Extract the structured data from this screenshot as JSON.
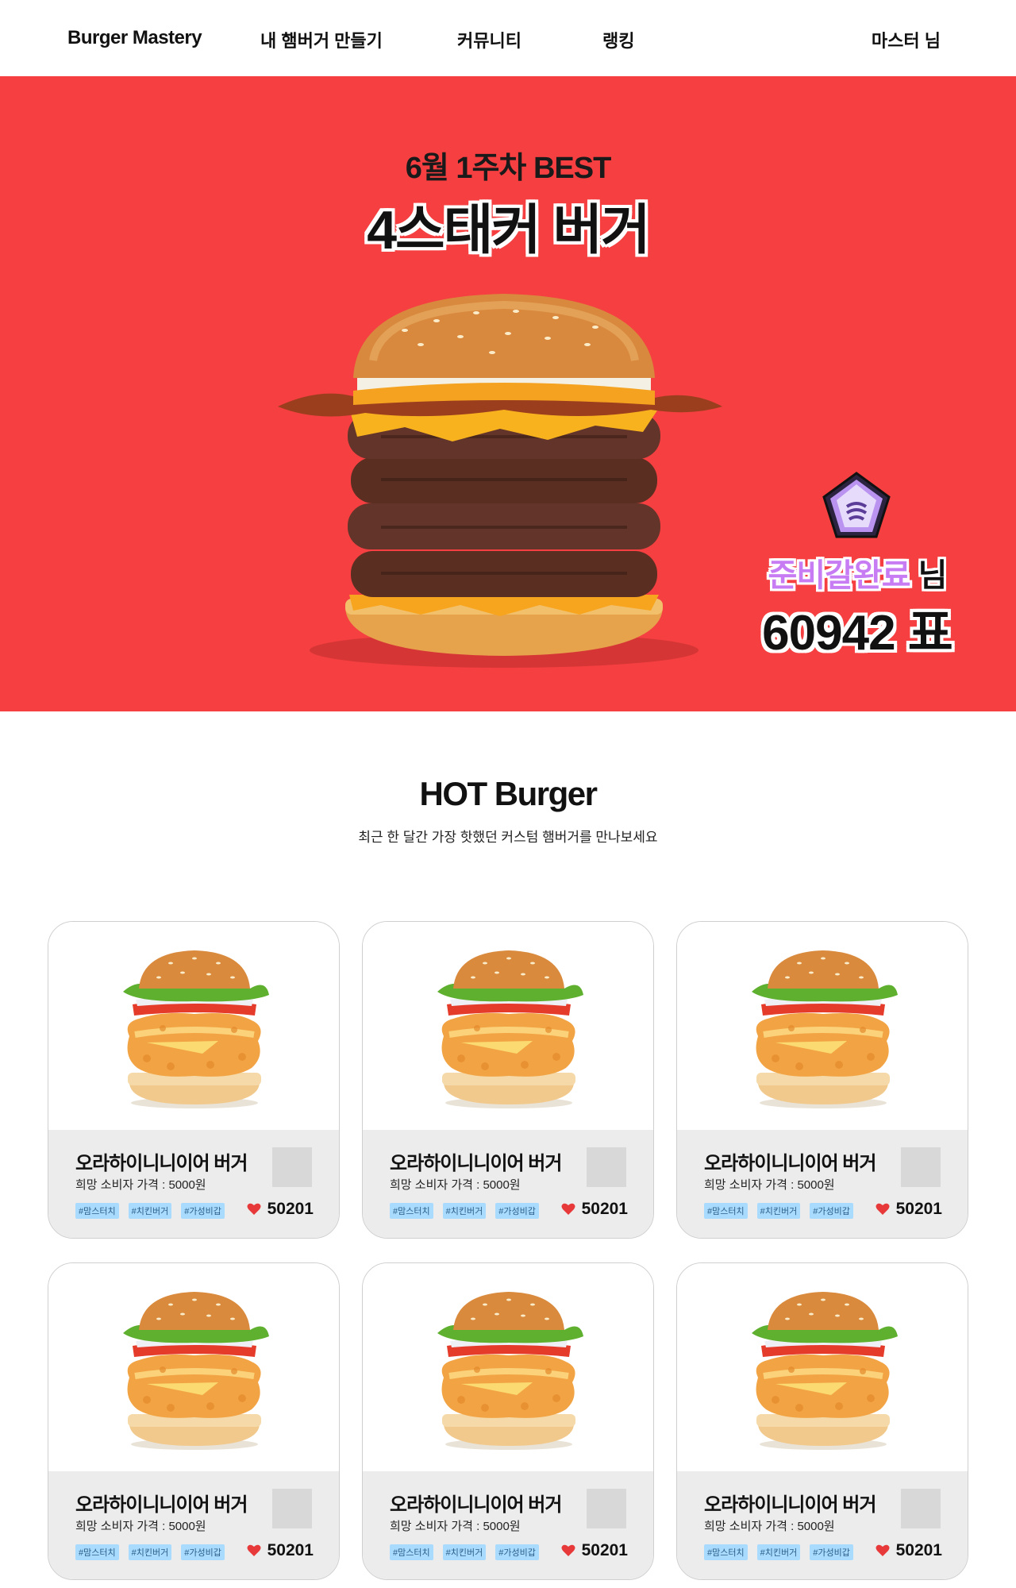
{
  "nav": {
    "brand": "Burger Mastery",
    "links": [
      "내 햄버거 만들기",
      "커뮤니티",
      "랭킹"
    ],
    "user": "마스터 님"
  },
  "hero": {
    "subtitle": "6월 1주차 BEST",
    "title": "4스태커 버거",
    "winner_name": "준비갈완료",
    "winner_suffix": " 님",
    "votes": "60942 표",
    "background_color": "#f53f40"
  },
  "hot": {
    "title": "HOT Burger",
    "subtitle": "최근 한 달간 가장 핫했던 커스텀 햄버거를 만나보세요"
  },
  "cards": [
    {
      "name": "오라하이니니이어 버거",
      "price": "희망 소비자 가격 : 5000원",
      "tags": [
        "#맘스터치",
        "#치킨버거",
        "#가성비갑"
      ],
      "likes": "50201"
    },
    {
      "name": "오라하이니니이어 버거",
      "price": "희망 소비자 가격 : 5000원",
      "tags": [
        "#맘스터치",
        "#치킨버거",
        "#가성비갑"
      ],
      "likes": "50201"
    },
    {
      "name": "오라하이니니이어 버거",
      "price": "희망 소비자 가격 : 5000원",
      "tags": [
        "#맘스터치",
        "#치킨버거",
        "#가성비갑"
      ],
      "likes": "50201"
    },
    {
      "name": "오라하이니니이어 버거",
      "price": "희망 소비자 가격 : 5000원",
      "tags": [
        "#맘스터치",
        "#치킨버거",
        "#가성비갑"
      ],
      "likes": "50201"
    },
    {
      "name": "오라하이니니이어 버거",
      "price": "희망 소비자 가격 : 5000원",
      "tags": [
        "#맘스터치",
        "#치킨버거",
        "#가성비갑"
      ],
      "likes": "50201"
    },
    {
      "name": "오라하이니니이어 버거",
      "price": "희망 소비자 가격 : 5000원",
      "tags": [
        "#맘스터치",
        "#치킨버거",
        "#가성비갑"
      ],
      "likes": "50201"
    }
  ],
  "icons": {
    "like": "heart-icon",
    "rank_badge": "pentagon-badge-icon"
  },
  "colors": {
    "accent_red": "#f53f40",
    "tag_bg": "#a9dbff",
    "heart": "#e8393a"
  }
}
